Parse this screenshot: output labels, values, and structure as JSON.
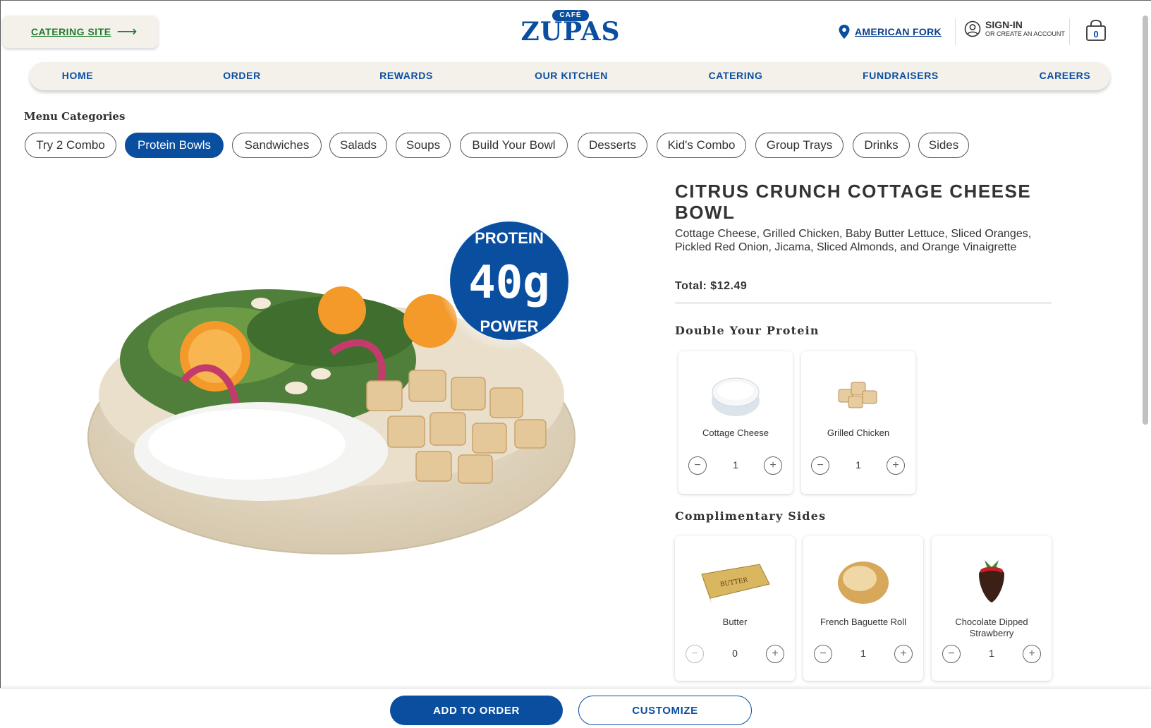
{
  "header": {
    "catering_link": "CATERING SITE",
    "logo_cafe": "CAFÉ",
    "logo_name": "ZUPAS",
    "location": "AMERICAN FORK",
    "signin": "SIGN-IN",
    "signin_sub": "OR CREATE AN ACCOUNT",
    "cart_count": "0"
  },
  "nav": {
    "items": [
      {
        "label": "HOME"
      },
      {
        "label": "ORDER"
      },
      {
        "label": "REWARDS"
      },
      {
        "label": "OUR KITCHEN"
      },
      {
        "label": "CATERING"
      },
      {
        "label": "FUNDRAISERS"
      },
      {
        "label": "CAREERS"
      }
    ]
  },
  "menu": {
    "label": "Menu Categories",
    "categories": [
      {
        "label": "Try 2 Combo",
        "active": false
      },
      {
        "label": "Protein Bowls",
        "active": true
      },
      {
        "label": "Sandwiches",
        "active": false
      },
      {
        "label": "Salads",
        "active": false
      },
      {
        "label": "Soups",
        "active": false
      },
      {
        "label": "Build Your Bowl",
        "active": false
      },
      {
        "label": "Desserts",
        "active": false
      },
      {
        "label": "Kid's Combo",
        "active": false
      },
      {
        "label": "Group Trays",
        "active": false
      },
      {
        "label": "Drinks",
        "active": false
      },
      {
        "label": "Sides",
        "active": false
      }
    ]
  },
  "product": {
    "badge_top": "PROTEIN",
    "badge_value": "40g",
    "badge_bottom": "POWER",
    "title": "CITRUS CRUNCH COTTAGE CHEESE BOWL",
    "description": "Cottage Cheese, Grilled Chicken, Baby Butter Lettuce, Sliced Oranges, Pickled Red Onion, Jicama, Sliced Almonds, and Orange Vinaigrette",
    "total": "Total: $12.49"
  },
  "double_protein": {
    "heading": "Double Your Protein",
    "items": [
      {
        "name": "Cottage Cheese",
        "qty": "1",
        "minus": "−",
        "plus": "+"
      },
      {
        "name": "Grilled Chicken",
        "qty": "1",
        "minus": "−",
        "plus": "+"
      }
    ]
  },
  "sides": {
    "heading": "Complimentary Sides",
    "items": [
      {
        "name": "Butter",
        "qty": "0",
        "minus": "−",
        "plus": "+"
      },
      {
        "name": "French Baguette Roll",
        "qty": "1",
        "minus": "−",
        "plus": "+"
      },
      {
        "name": "Chocolate Dipped Strawberry",
        "qty": "1",
        "minus": "−",
        "plus": "+"
      }
    ]
  },
  "actions": {
    "add": "ADD TO ORDER",
    "customize": "CUSTOMIZE"
  },
  "colors": {
    "brand_blue": "#0a4ea0",
    "catering_green": "#1f7a2e",
    "nav_bg": "#f3f1ea"
  }
}
